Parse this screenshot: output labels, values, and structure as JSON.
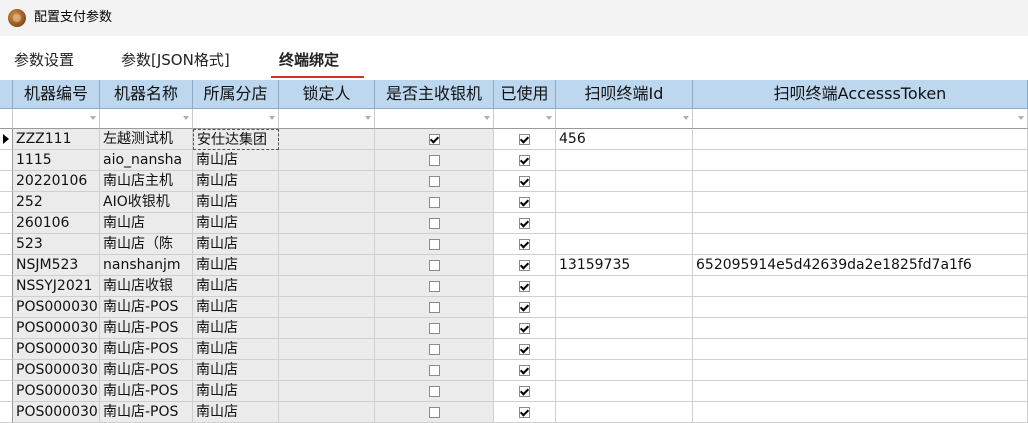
{
  "window": {
    "title": "配置支付参数"
  },
  "tabs": [
    {
      "label": "参数设置"
    },
    {
      "label": "参数[JSON格式]"
    },
    {
      "label": "终端绑定"
    }
  ],
  "grid": {
    "columns": [
      "机器编号",
      "机器名称",
      "所属分店",
      "锁定人",
      "是否主收银机",
      "已使用",
      "扫呗终端Id",
      "扫呗终端AccesssToken"
    ],
    "rows": [
      {
        "id": "ZZZ111",
        "name": "左越测试机",
        "store": "安仕达集团",
        "locker": "",
        "is_main": true,
        "used": true,
        "terminal_id": "456",
        "token": ""
      },
      {
        "id": "1115",
        "name": "aio_nansha",
        "store": "南山店",
        "locker": "",
        "is_main": false,
        "used": true,
        "terminal_id": "",
        "token": ""
      },
      {
        "id": "20220106",
        "name": "南山店主机",
        "store": "南山店",
        "locker": "",
        "is_main": false,
        "used": true,
        "terminal_id": "",
        "token": ""
      },
      {
        "id": "252",
        "name": "AIO收银机",
        "store": "南山店",
        "locker": "",
        "is_main": false,
        "used": true,
        "terminal_id": "",
        "token": ""
      },
      {
        "id": "260106",
        "name": "南山店",
        "store": "南山店",
        "locker": "",
        "is_main": false,
        "used": true,
        "terminal_id": "",
        "token": ""
      },
      {
        "id": "523",
        "name": "南山店（陈",
        "store": "南山店",
        "locker": "",
        "is_main": false,
        "used": true,
        "terminal_id": "",
        "token": ""
      },
      {
        "id": "NSJM523",
        "name": "nanshanjm",
        "store": "南山店",
        "locker": "",
        "is_main": false,
        "used": true,
        "terminal_id": "13159735",
        "token": "652095914e5d42639da2e1825fd7a1f6"
      },
      {
        "id": "NSSYJ2021",
        "name": "南山店收银",
        "store": "南山店",
        "locker": "",
        "is_main": false,
        "used": true,
        "terminal_id": "",
        "token": ""
      },
      {
        "id": "POS000030",
        "name": "南山店-POS",
        "store": "南山店",
        "locker": "",
        "is_main": false,
        "used": true,
        "terminal_id": "",
        "token": ""
      },
      {
        "id": "POS000030",
        "name": "南山店-POS",
        "store": "南山店",
        "locker": "",
        "is_main": false,
        "used": true,
        "terminal_id": "",
        "token": ""
      },
      {
        "id": "POS000030",
        "name": "南山店-POS",
        "store": "南山店",
        "locker": "",
        "is_main": false,
        "used": true,
        "terminal_id": "",
        "token": ""
      },
      {
        "id": "POS000030",
        "name": "南山店-POS",
        "store": "南山店",
        "locker": "",
        "is_main": false,
        "used": true,
        "terminal_id": "",
        "token": ""
      },
      {
        "id": "POS000030",
        "name": "南山店-POS",
        "store": "南山店",
        "locker": "",
        "is_main": false,
        "used": true,
        "terminal_id": "",
        "token": ""
      },
      {
        "id": "POS000030",
        "name": "南山店-POS",
        "store": "南山店",
        "locker": "",
        "is_main": false,
        "used": true,
        "terminal_id": "",
        "token": ""
      }
    ]
  },
  "colors": {
    "header_bg": "#bdd7ee",
    "readonly_bg": "#ebebeb",
    "tab_accent": "#d93025"
  }
}
